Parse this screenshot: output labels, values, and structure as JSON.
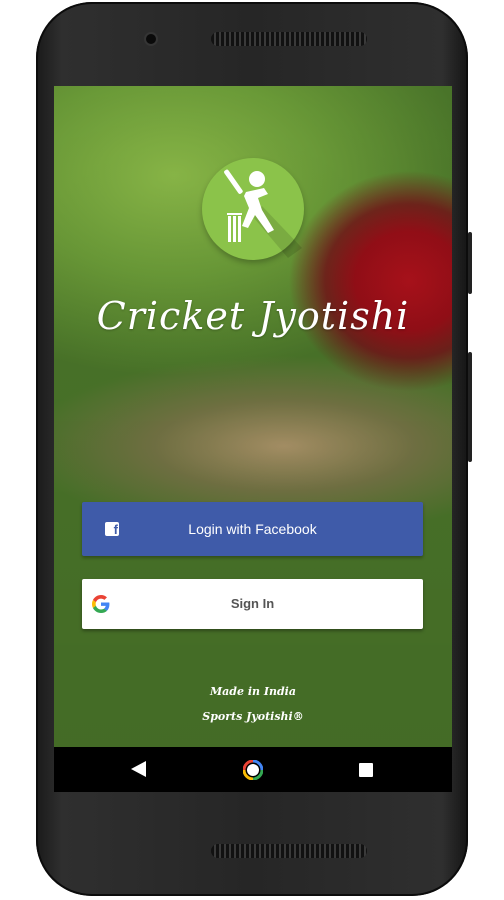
{
  "app": {
    "title": "Cricket Jyotishi"
  },
  "buttons": {
    "facebook_label": "Login with Facebook",
    "google_label": "Sign In"
  },
  "footer": {
    "line1": "Made in India",
    "line2": "Sports Jyotishi®"
  },
  "icons": {
    "logo": "cricket-batsman-icon",
    "facebook": "facebook-icon",
    "google": "google-icon",
    "nav_back": "back-triangle-icon",
    "nav_home": "home-circle-icon",
    "nav_recent": "recents-square-icon"
  },
  "colors": {
    "logo_green": "#8bc34a",
    "facebook_blue": "#3f5ba9",
    "google_button_bg": "#ffffff",
    "nav_bar": "#000000"
  }
}
